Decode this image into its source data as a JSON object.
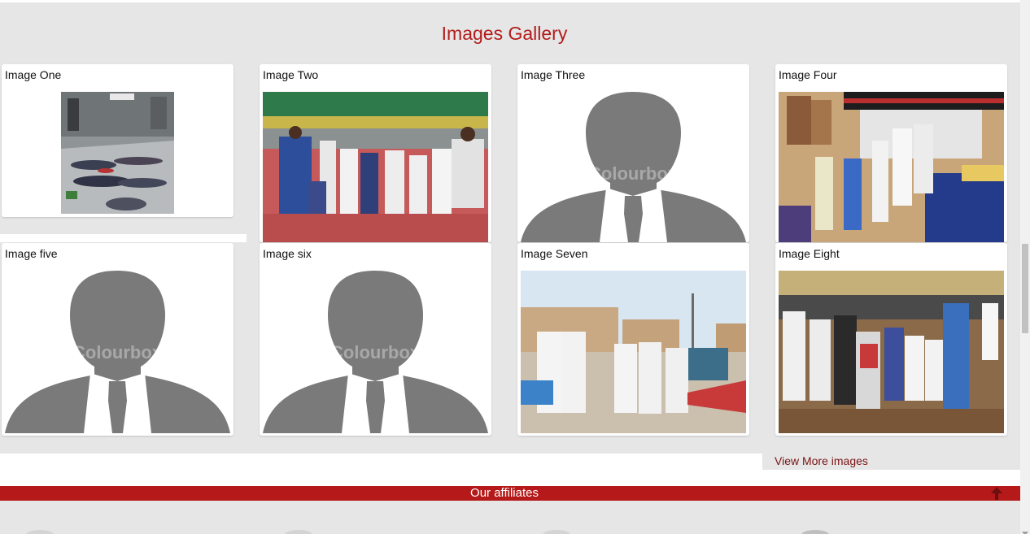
{
  "gallery": {
    "title": "Images Gallery",
    "items": [
      {
        "label": "Image One",
        "image": "people-stretching-in-hall"
      },
      {
        "label": "Image Two",
        "image": "children-with-certificates-in-arena"
      },
      {
        "label": "Image Three",
        "image": "placeholder-silhouette"
      },
      {
        "label": "Image Four",
        "image": "athletes-on-podium"
      },
      {
        "label": "Image five",
        "image": "placeholder-silhouette"
      },
      {
        "label": "Image six",
        "image": "placeholder-silhouette"
      },
      {
        "label": "Image Seven",
        "image": "athletes-outdoors"
      },
      {
        "label": "Image Eight",
        "image": "team-group-photo-in-arena"
      }
    ],
    "watermark": "Colourbox",
    "view_more": "View More images"
  },
  "affiliates": {
    "title": "Our affiliates",
    "back_to_top_icon": "arrow-up-icon"
  },
  "colors": {
    "accent": "#b51919",
    "title": "#b31b1b",
    "link": "#7b1414",
    "background": "#e6e6e6",
    "silhouette": "#7a7a7a"
  }
}
